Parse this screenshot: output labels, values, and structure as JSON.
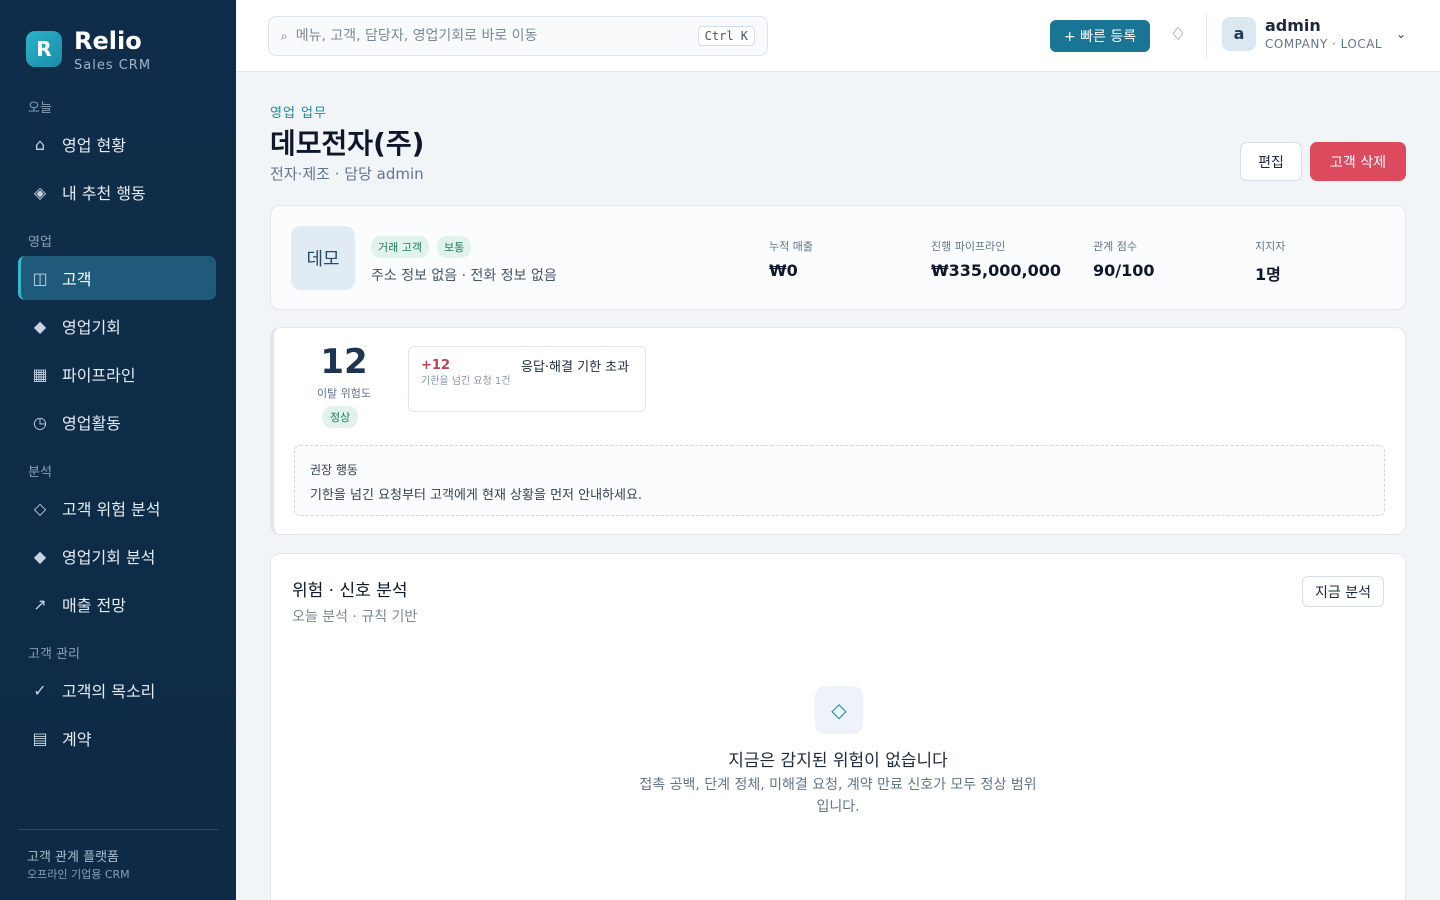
{
  "brand": {
    "logo_letter": "R",
    "name": "Relio",
    "subtitle": "Sales CRM"
  },
  "sidebar": {
    "sections": [
      {
        "label": "오늘"
      },
      {
        "label": "영업"
      },
      {
        "label": "분석"
      },
      {
        "label": "고객 관리"
      }
    ],
    "items": [
      {
        "label": "영업 현황",
        "icon": "home-icon",
        "glyph": "⌂"
      },
      {
        "label": "내 추천 행동",
        "icon": "sparkle-icon",
        "glyph": "◈"
      },
      {
        "label": "고객",
        "icon": "customers-icon",
        "glyph": "◫",
        "active": true
      },
      {
        "label": "영업기회",
        "icon": "diamond-icon",
        "glyph": "◆"
      },
      {
        "label": "파이프라인",
        "icon": "grid-icon",
        "glyph": "▦"
      },
      {
        "label": "영업활동",
        "icon": "clock-icon",
        "glyph": "◷"
      },
      {
        "label": "고객 위험 분석",
        "icon": "risk-icon",
        "glyph": "◇"
      },
      {
        "label": "영업기회 분석",
        "icon": "opportunity-icon",
        "glyph": "◆"
      },
      {
        "label": "매출 전망",
        "icon": "trend-icon",
        "glyph": "↗"
      },
      {
        "label": "고객의 목소리",
        "icon": "check-icon",
        "glyph": "✓"
      },
      {
        "label": "계약",
        "icon": "contract-icon",
        "glyph": "▤"
      }
    ],
    "footer": {
      "title": "고객 관계 플랫폼",
      "subtitle": "오프라인 기업용 CRM"
    }
  },
  "topbar": {
    "search_placeholder": "메뉴, 고객, 담당자, 영업기회로 바로 이동",
    "search_icon": "⌕",
    "shortcut": "Ctrl K",
    "quick_add_label": "+ 빠른 등록",
    "notification_glyph": "♢",
    "user": {
      "initial": "a",
      "name": "admin",
      "role": "COMPANY · LOCAL",
      "chevron": "⌄"
    }
  },
  "header": {
    "eyebrow": "영업 업무",
    "title": "데모전자(주)",
    "subtitle": "전자·제조 · 담당 admin",
    "edit_label": "편집",
    "delete_label": "고객 삭제"
  },
  "profile": {
    "avatar_text": "데모",
    "tags": [
      "거래 고객",
      "보통"
    ],
    "meta": "주소 정보 없음 · 전화 정보 없음",
    "stats": [
      {
        "label": "누적 매출",
        "value": "₩0"
      },
      {
        "label": "진행 파이프라인",
        "value": "₩335,000,000"
      },
      {
        "label": "관계 점수",
        "value": "90/100"
      },
      {
        "label": "지지자",
        "value": "1명"
      }
    ]
  },
  "risk": {
    "score": "12",
    "score_label": "이탈 위험도",
    "status": "정상",
    "signal": {
      "delta": "+12",
      "title": "응답·해결 기한 초과",
      "description": "기한을 넘긴 요청 1건"
    },
    "recommendation_label": "권장 행동",
    "recommendation": "기한을 넘긴 요청부터 고객에게 현재 상황을 먼저 안내하세요."
  },
  "analysis": {
    "title": "위험 · 신호 분석",
    "subtitle": "오늘 분석 · 규칙 기반",
    "analyze_label": "지금 분석",
    "empty_glyph": "◇",
    "empty_title": "지금은 감지된 위험이 없습니다",
    "empty_desc": "접촉 공백, 단계 정체, 미해결 요청, 계약 만료 신호가 모두 정상 범위입니다."
  }
}
